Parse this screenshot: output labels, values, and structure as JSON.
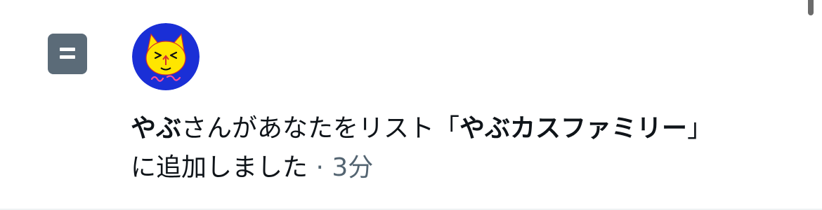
{
  "notification": {
    "icon": "list-icon",
    "avatar": {
      "icon": "yellow-cat-avatar",
      "signature": "やぶ"
    },
    "user_name": "やぶ",
    "text_before_list": "さんがあなたをリスト",
    "list_open_bracket": "「",
    "list_name": "やぶカスファミリー",
    "list_close_bracket": "」",
    "text_after_list": "に追加しました",
    "separator": " · ",
    "time": "3分"
  },
  "colors": {
    "icon_bg": "#5b6b78",
    "avatar_bg": "#1a2fd6",
    "cat_yellow": "#ffe600",
    "text": "#0f1419",
    "meta_text": "#536471"
  }
}
